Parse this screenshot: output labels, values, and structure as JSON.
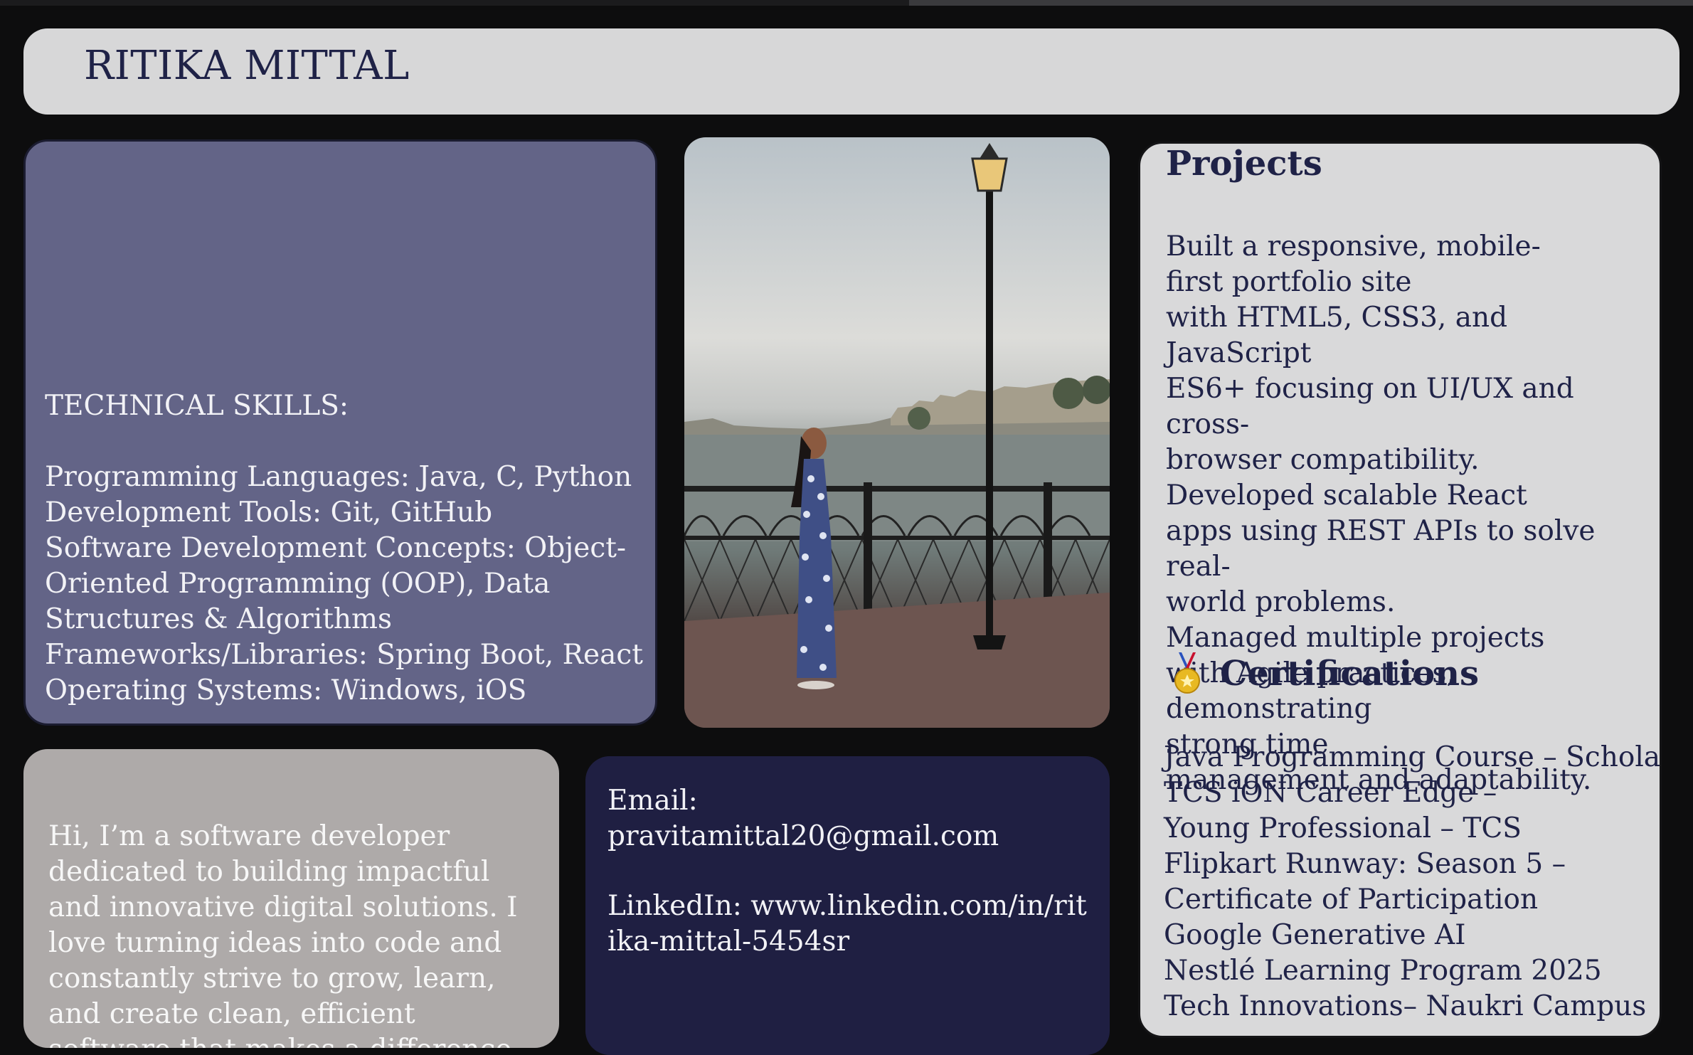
{
  "header": {
    "name": "RITIKA MITTAL"
  },
  "skills": {
    "heading": "TECHNICAL SKILLS:",
    "items": [
      "Programming Languages: Java, C, Python",
      "Development Tools: Git, GitHub",
      "Software Development Concepts: Object-Oriented Programming (OOP), Data Structures & Algorithms",
      "Frameworks/Libraries: Spring Boot, React",
      "Operating Systems: Windows, iOS"
    ]
  },
  "photo": {
    "subject": "portrait-photo"
  },
  "projects": {
    "title": "Projects",
    "lines": [
      "Built a responsive, mobile-",
      "first portfolio site",
      "with HTML5, CSS3, and JavaScript",
      "ES6+ focusing on UI/UX and cross-",
      "browser compatibility.",
      "Developed scalable React",
      "apps using REST APIs to solve real-",
      "world problems.",
      "Managed multiple projects",
      "with Agile practices, demonstrating",
      "strong time",
      "management and adaptability."
    ]
  },
  "certifications": {
    "icon": "medal-icon",
    "title": "Certifications",
    "items": [
      "Java Programming Course – ScholarHat",
      "TCS iON Career Edge – Young Professional – TCS",
      "Flipkart Runway: Season 5 – Certificate of Participation",
      "Google Generative AI",
      "Nestlé Learning Program 2025",
      "Tech Innovations– Naukri Campus"
    ]
  },
  "about": {
    "text": "Hi, I’m a software developer dedicated to building impactful and innovative digital solutions. I love turning ideas into code and constantly strive to grow, learn, and create clean, efficient software that makes a difference."
  },
  "contact": {
    "email_label": "Email:",
    "email": "pravitamittal20@gmail.com",
    "linkedin_label": "LinkedIn:",
    "linkedin": "www.linkedin.com/in/ritika-mittal-5454sr"
  },
  "colors": {
    "background": "#0d0d0e",
    "header": "#d7d7d8",
    "skills_card": "#636487",
    "projects_card": "#d9d9da",
    "about_card": "#aeaaa9",
    "contact_card": "#1f1f42",
    "text_dark": "#1f2247"
  }
}
